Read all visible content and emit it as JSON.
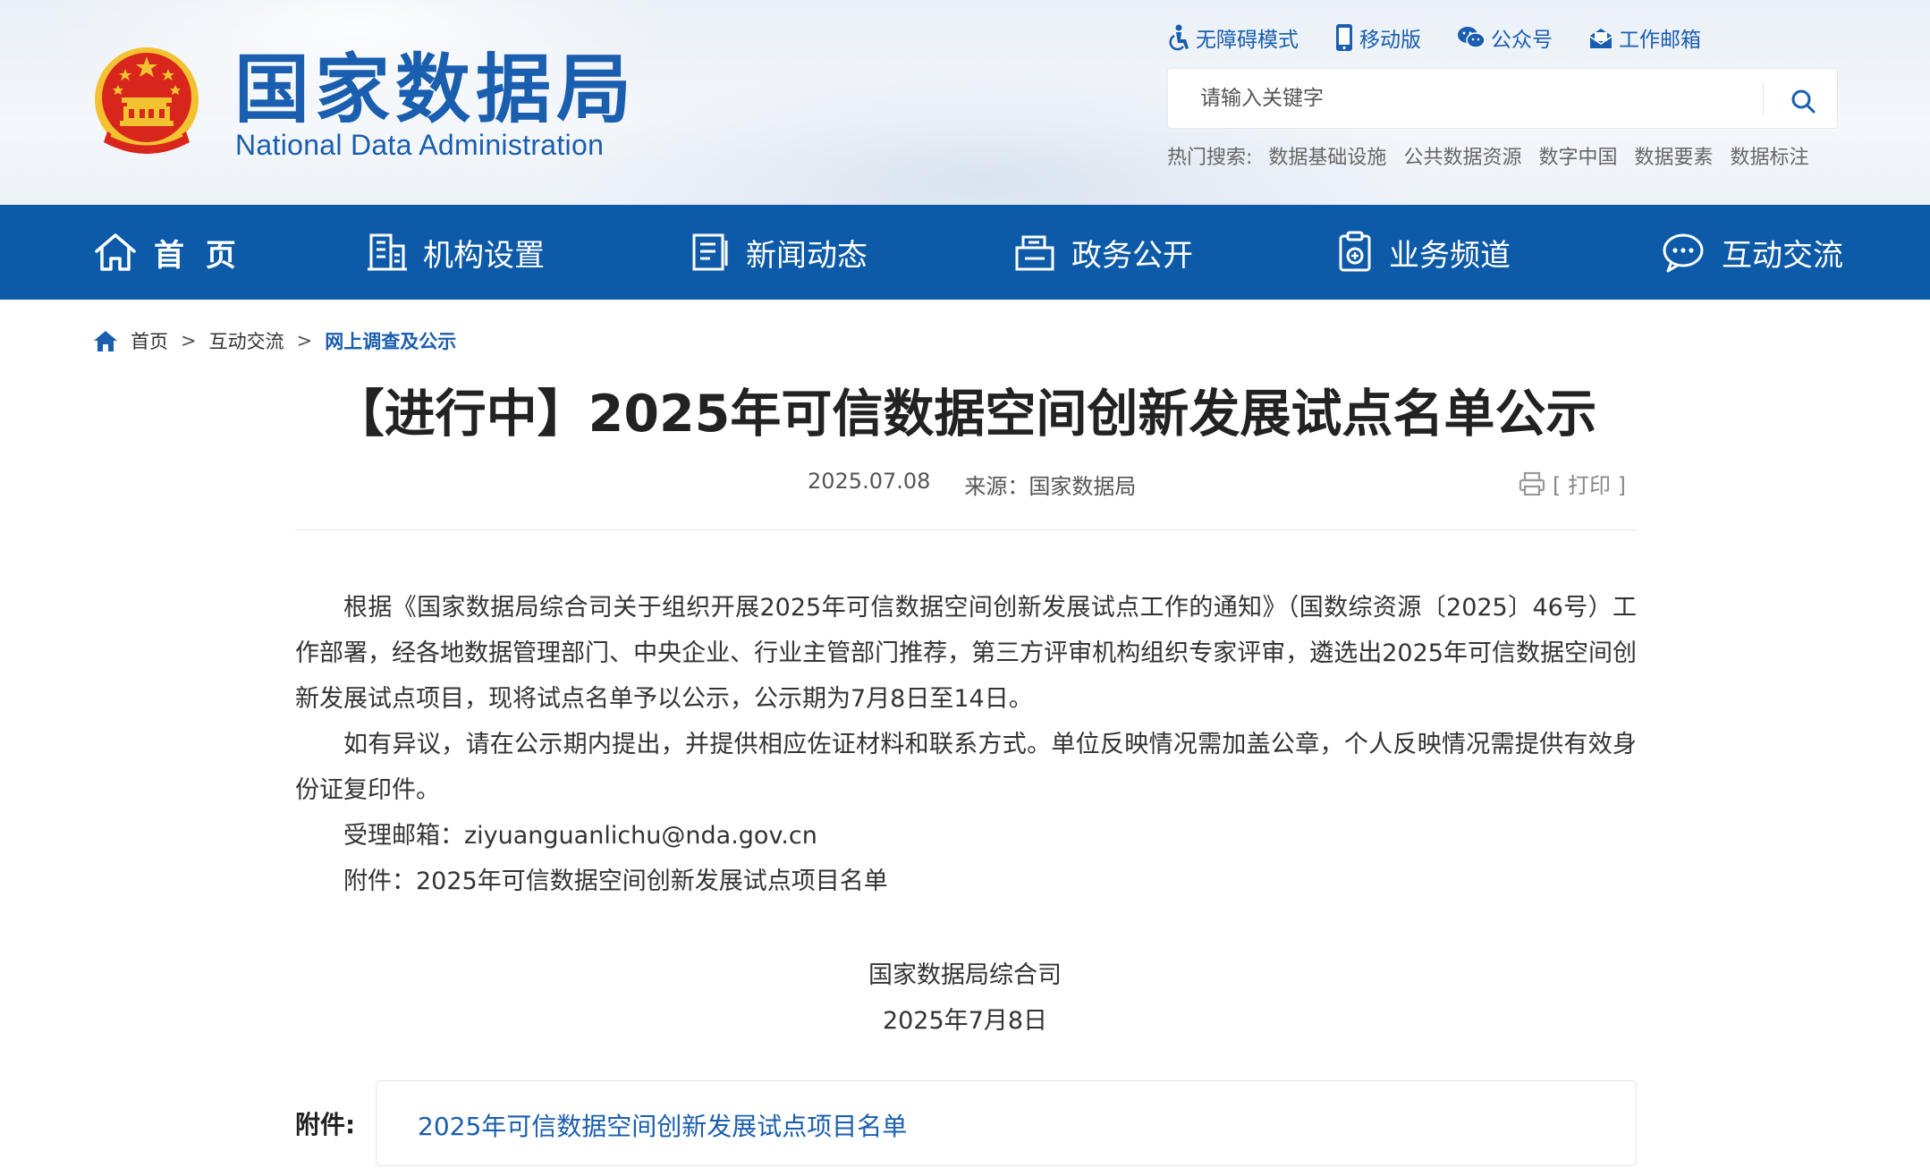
{
  "site": {
    "title": "国家数据局",
    "subtitle": "National Data Administration"
  },
  "toplinks": [
    {
      "label": "无障碍模式",
      "icon": "accessibility-icon"
    },
    {
      "label": "移动版",
      "icon": "mobile-icon"
    },
    {
      "label": "公众号",
      "icon": "wechat-icon"
    },
    {
      "label": "工作邮箱",
      "icon": "mail-icon"
    }
  ],
  "search": {
    "placeholder": "请输入关键字"
  },
  "hot_search": {
    "label": "热门搜索:",
    "items": [
      "数据基础设施",
      "公共数据资源",
      "数字中国",
      "数据要素",
      "数据标注"
    ]
  },
  "nav": {
    "items": [
      {
        "label": "首 页",
        "icon": "home-icon"
      },
      {
        "label": "机构设置",
        "icon": "building-icon"
      },
      {
        "label": "新闻动态",
        "icon": "news-icon"
      },
      {
        "label": "政务公开",
        "icon": "document-icon"
      },
      {
        "label": "业务频道",
        "icon": "clipboard-icon"
      },
      {
        "label": "互动交流",
        "icon": "chat-icon"
      }
    ]
  },
  "breadcrumb": {
    "items": [
      "首页",
      "互动交流",
      "网上调查及公示"
    ],
    "separator": ">"
  },
  "article": {
    "title": "【进行中】2025年可信数据空间创新发展试点名单公示",
    "date": "2025.07.08",
    "source": "来源：国家数据局",
    "print_label": "[ 打印 ]",
    "paragraphs": [
      "根据《国家数据局综合司关于组织开展2025年可信数据空间创新发展试点工作的通知》（国数综资源〔2025〕46号）工作部署，经各地数据管理部门、中央企业、行业主管部门推荐，第三方评审机构组织专家评审，遴选出2025年可信数据空间创新发展试点项目，现将试点名单予以公示，公示期为7月8日至14日。",
      "如有异议，请在公示期内提出，并提供相应佐证材料和联系方式。单位反映情况需加盖公章，个人反映情况需提供有效身份证复印件。",
      "受理邮箱：ziyuanguanlichu@nda.gov.cn",
      "附件：2025年可信数据空间创新发展试点项目名单"
    ],
    "signature_org": "国家数据局综合司",
    "signature_date": "2025年7月8日",
    "attachment_label": "附件:",
    "attachment_link": "2025年可信数据空间创新发展试点项目名单"
  },
  "colors": {
    "brand_blue": "#1a5eaf",
    "nav_blue": "#0d5aa8",
    "emblem_red": "#d9261c",
    "emblem_gold": "#f2c230"
  }
}
